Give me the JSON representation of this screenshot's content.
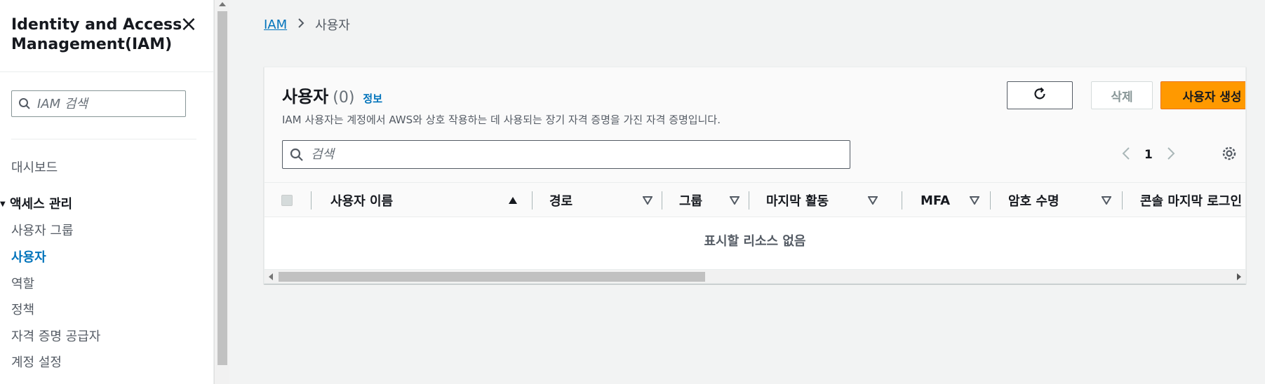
{
  "sidebar": {
    "title": "Identity and Access Management(IAM)",
    "search_placeholder": "IAM 검색",
    "dashboard": "대시보드",
    "section_access": "액세스 관리",
    "items": [
      {
        "label": "사용자 그룹"
      },
      {
        "label": "사용자"
      },
      {
        "label": "역할"
      },
      {
        "label": "정책"
      },
      {
        "label": "자격 증명 공급자"
      },
      {
        "label": "계정 설정"
      }
    ],
    "active_item": "사용자"
  },
  "breadcrumb": {
    "root": "IAM",
    "current": "사용자"
  },
  "panel": {
    "title": "사용자",
    "count": "(0)",
    "info_link": "정보",
    "description": "IAM 사용자는 계정에서 AWS와 상호 작용하는 데 사용되는 장기 자격 증명을 가진 자격 증명입니다.",
    "buttons": {
      "delete": "삭제",
      "create": "사용자 생성"
    },
    "search_placeholder": "검색",
    "pagination": {
      "current_page": "1"
    },
    "columns": [
      {
        "label": "사용자 이름",
        "sort": "ascending"
      },
      {
        "label": "경로",
        "sort": "none"
      },
      {
        "label": "그룹",
        "sort": "none"
      },
      {
        "label": "마지막 활동",
        "sort": "none"
      },
      {
        "label": "MFA",
        "sort": "none"
      },
      {
        "label": "암호 수명",
        "sort": "none"
      },
      {
        "label": "콘솔 마지막 로그인",
        "sort": "none"
      }
    ],
    "empty_message": "표시할 리소스 없음"
  },
  "colors": {
    "primary_button": "#ff9900",
    "link": "#0073bb"
  }
}
